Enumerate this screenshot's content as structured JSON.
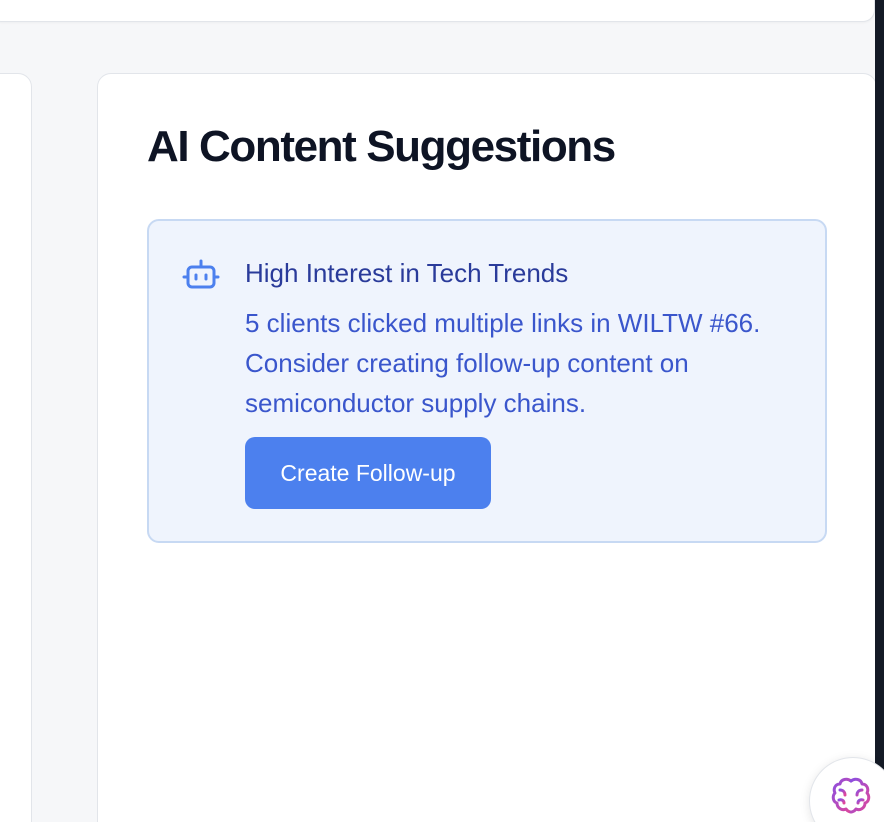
{
  "suggestions_panel": {
    "title": "AI Content Suggestions",
    "items": [
      {
        "icon": "robot-icon",
        "title": "High Interest in Tech Trends",
        "body": "5 clients clicked multiple links in WILTW #66. Consider creating follow-up content on semiconductor supply chains.",
        "action_label": "Create Follow-up"
      }
    ]
  },
  "assistant_button": {
    "icon": "brain-icon"
  },
  "colors": {
    "accent": "#4c80ee",
    "suggestion_bg": "#eff4fd",
    "suggestion_border": "#c7d9f3",
    "title_text": "#0e1424",
    "suggestion_title": "#2a3b9a",
    "suggestion_body": "#3a56cc"
  }
}
